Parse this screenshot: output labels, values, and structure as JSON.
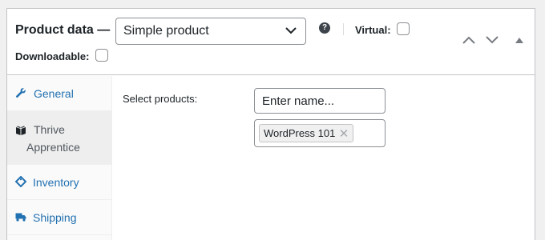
{
  "header": {
    "title": "Product data —",
    "product_type": {
      "selected": "Simple product"
    },
    "virtual_label": "Virtual:",
    "downloadable_label": "Downloadable:"
  },
  "tabs": [
    {
      "label": "General",
      "icon": "wrench-icon",
      "active": false
    },
    {
      "label_line1": "Thrive",
      "label_line2": "Apprentice",
      "icon": "book-icon",
      "active": true
    },
    {
      "label": "Inventory",
      "icon": "tag-icon",
      "active": false
    },
    {
      "label": "Shipping",
      "icon": "truck-icon",
      "active": false
    }
  ],
  "panel": {
    "select_label": "Select products:",
    "search_placeholder": "Enter name...",
    "selected_tags": [
      {
        "label": "WordPress 101"
      }
    ]
  },
  "colors": {
    "link": "#2271b1",
    "active_tab_bg": "#eeeeee",
    "border": "#c3c4c7",
    "text": "#1d2327"
  }
}
